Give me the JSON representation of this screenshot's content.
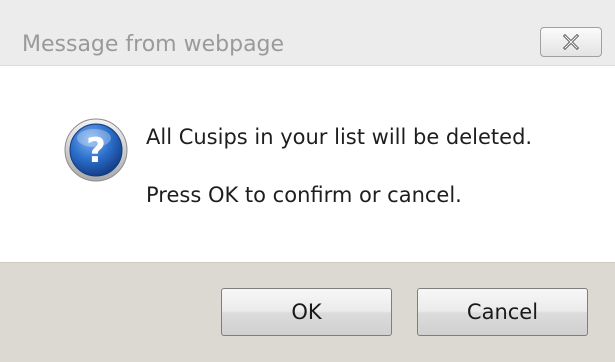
{
  "window": {
    "title": "Message from webpage",
    "close_icon": "close-x-icon"
  },
  "message": {
    "icon": "question-icon",
    "line1": "All Cusips in your list will be deleted.",
    "line2": "Press OK to confirm or cancel."
  },
  "buttons": {
    "ok_label": "OK",
    "cancel_label": "Cancel"
  },
  "colors": {
    "icon_blue": "#1f5fb8",
    "footer_bg": "#dcd9d3"
  }
}
